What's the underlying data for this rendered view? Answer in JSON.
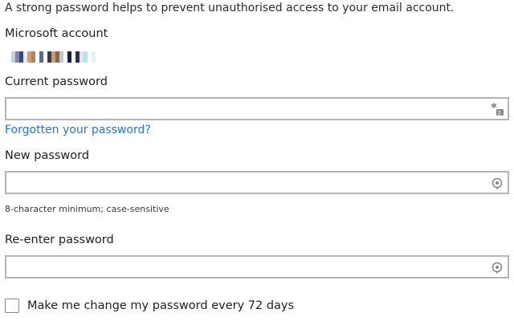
{
  "intro_text": "A strong password helps to prevent unauthorised access to your email account.",
  "account": {
    "label": "Microsoft account",
    "redacted_colors": [
      "#c8d0dc",
      "#7a8aa8",
      "#3a4a78",
      "#e8ecf0",
      "#d0a070",
      "#a88860",
      "#ffffff",
      "#5a6a90",
      "#ffffff",
      "#3a3a58",
      "#c8a070",
      "#886848",
      "#c0c8d8",
      "#ffffff",
      "#1a2040",
      "#ffffff",
      "#2a3050",
      "#e0e4ea",
      "#b8e0f0",
      "#ffffff",
      "#e8f0f4"
    ]
  },
  "current_password": {
    "label": "Current password",
    "value": "",
    "icon": "password-keyboard-icon"
  },
  "forgot_link": "Forgotten your password?",
  "new_password": {
    "label": "New password",
    "value": "",
    "icon": "reveal-password-icon",
    "hint": "8-character minimum; case-sensitive"
  },
  "reenter_password": {
    "label": "Re-enter password",
    "value": "",
    "icon": "reveal-password-icon"
  },
  "expire_option": {
    "label": "Make me change my password every 72 days",
    "checked": false
  },
  "colors": {
    "link": "#2672ec",
    "border": "#b4b4b4"
  }
}
